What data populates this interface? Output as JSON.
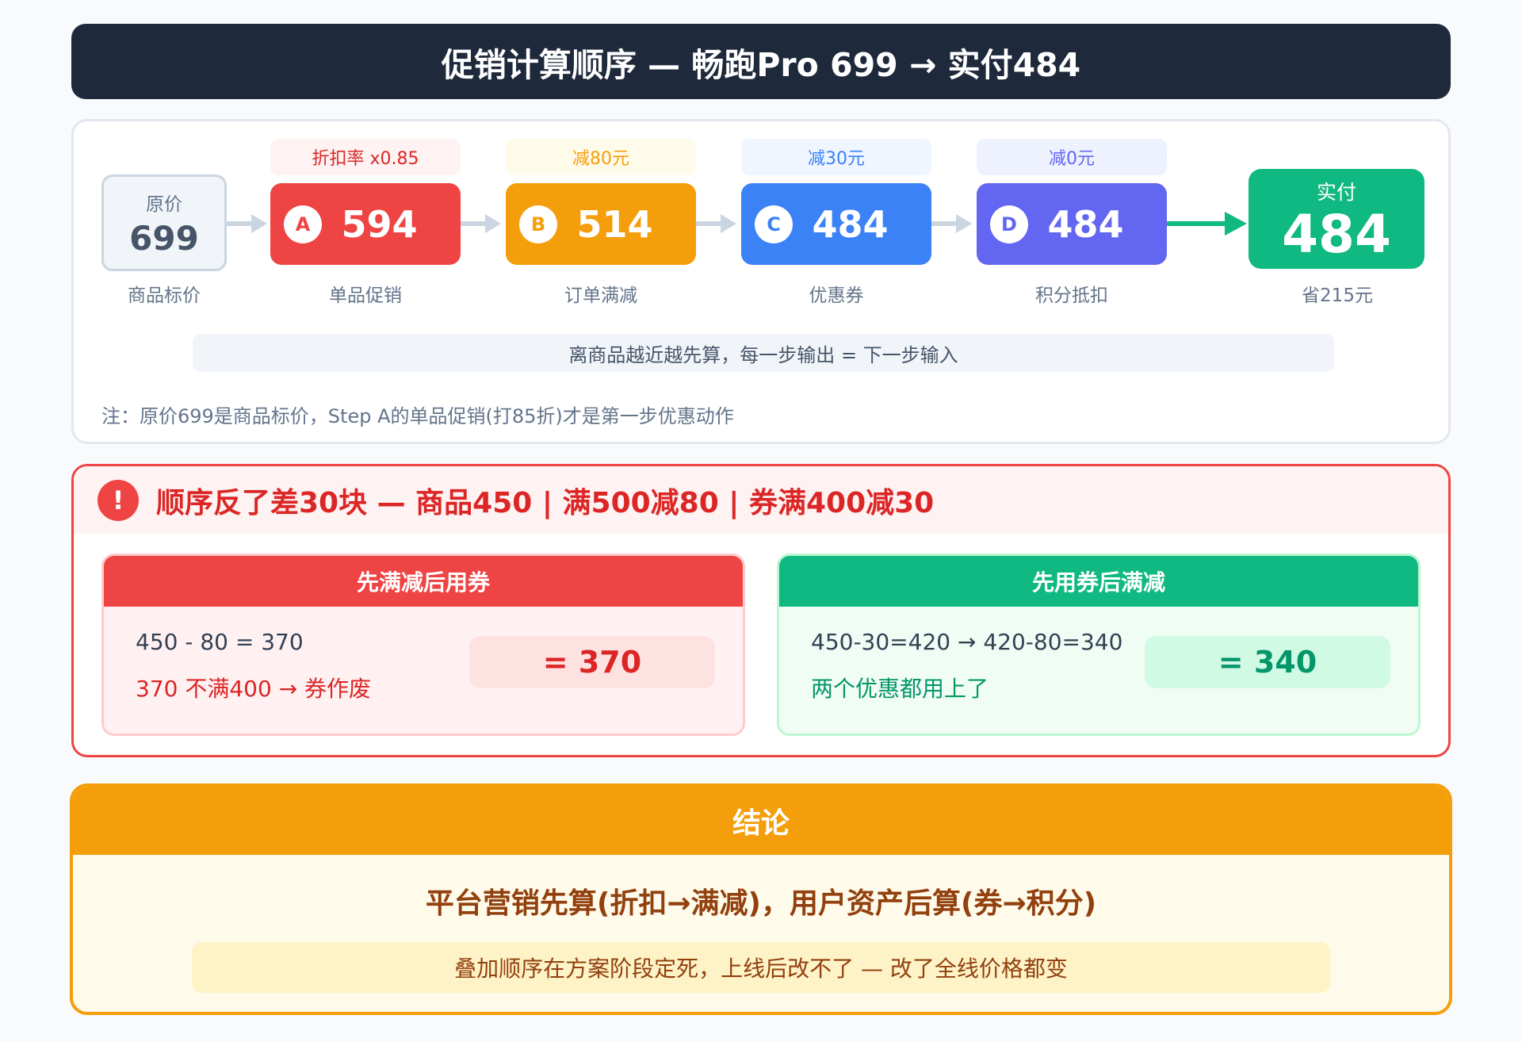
{
  "title": "促销计算顺序 — 畅跑Pro 699 → 实付484",
  "flow": {
    "original": {
      "label": "原价",
      "value": "699",
      "caption": "商品标价"
    },
    "steps": [
      {
        "badge": "A",
        "tag": "折扣率 x0.85",
        "value": "594",
        "caption": "单品促销",
        "color": "#ef4444",
        "tag_bg": "#fef2f2",
        "tag_color": "#dc2626"
      },
      {
        "badge": "B",
        "tag": "减80元",
        "value": "514",
        "caption": "订单满减",
        "color": "#f59e0b",
        "tag_bg": "#fffbeb",
        "tag_color": "#f59e0b"
      },
      {
        "badge": "C",
        "tag": "减30元",
        "value": "484",
        "caption": "优惠券",
        "color": "#3b82f6",
        "tag_bg": "#eff6ff",
        "tag_color": "#3b82f6"
      },
      {
        "badge": "D",
        "tag": "减0元",
        "value": "484",
        "caption": "积分抵扣",
        "color": "#6366f1",
        "tag_bg": "#eef2ff",
        "tag_color": "#6366f1"
      }
    ],
    "final": {
      "label": "实付",
      "value": "484",
      "caption": "省215元",
      "color": "#10b981"
    },
    "note": "离商品越近越先算，每一步输出 = 下一步输入",
    "footnote": "注：原价699是商品标价，Step A的单品促销(打85折)才是第一步优惠动作"
  },
  "warning": {
    "icon": "!",
    "title": "顺序反了差30块 — 商品450 | 满500减80 | 券满400减30",
    "wrong": {
      "header": "先满减后用券",
      "line1": "450 - 80 = 370",
      "line2": "370 不满400 → 券作废",
      "result": "= 370"
    },
    "right": {
      "header": "先用券后满减",
      "line1": "450-30=420 → 420-80=340",
      "line2": "两个优惠都用上了",
      "result": "= 340"
    }
  },
  "conclusion": {
    "header": "结论",
    "main": "平台营销先算(折扣→满减)，用户资产后算(券→积分)",
    "note": "叠加顺序在方案阶段定死，上线后改不了 — 改了全线价格都变"
  }
}
